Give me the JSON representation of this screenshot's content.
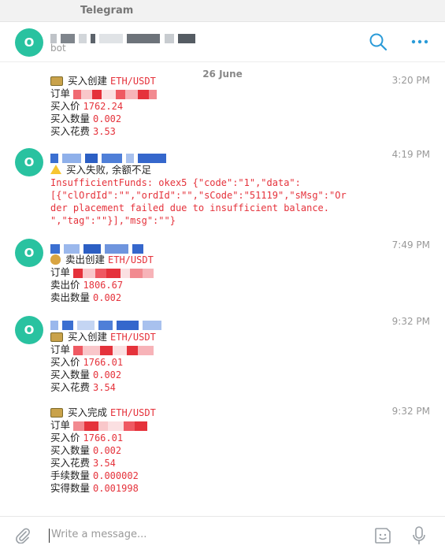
{
  "window": {
    "title": "Telegram"
  },
  "header": {
    "avatar_letter": "O",
    "subtitle": "bot"
  },
  "colors": {
    "accent": "#2a9bd8",
    "avatar": "#29c2a0",
    "red": "#e5323b"
  },
  "date_separator": "26 June",
  "messages": [
    {
      "time": "3:20 PM",
      "lines": [
        {
          "label": "买入创建",
          "value": "ETH/USDT"
        },
        {
          "label": "订单",
          "value": ""
        },
        {
          "label": "买入价",
          "value": "1762.24"
        },
        {
          "label": "买入数量",
          "value": "0.002"
        },
        {
          "label": "买入花费",
          "value": "3.53"
        }
      ]
    },
    {
      "time": "4:19 PM",
      "avatar_letter": "O",
      "title": "买入失败, 余额不足",
      "error_lines": [
        "InsufficientFunds: okex5 {\"code\":\"1\",\"data\":",
        "[{\"clOrdId\":\"\",\"ordId\":\"\",\"sCode\":\"51119\",\"sMsg\":\"Or",
        "der placement failed due to insufficient balance.",
        "\",\"tag\":\"\"}],\"msg\":\"\"}"
      ]
    },
    {
      "time": "7:49 PM",
      "avatar_letter": "O",
      "lines": [
        {
          "label": "卖出创建",
          "value": "ETH/USDT"
        },
        {
          "label": "订单",
          "value": ""
        },
        {
          "label": "卖出价",
          "value": "1806.67"
        },
        {
          "label": "卖出数量",
          "value": "0.002"
        }
      ]
    },
    {
      "time": "9:32 PM",
      "avatar_letter": "O",
      "lines": [
        {
          "label": "买入创建",
          "value": "ETH/USDT"
        },
        {
          "label": "订单",
          "value": ""
        },
        {
          "label": "买入价",
          "value": "1766.01"
        },
        {
          "label": "买入数量",
          "value": "0.002"
        },
        {
          "label": "买入花费",
          "value": "3.54"
        }
      ]
    },
    {
      "time": "9:32 PM",
      "lines": [
        {
          "label": "买入完成",
          "value": "ETH/USDT"
        },
        {
          "label": "订单",
          "value": ""
        },
        {
          "label": "买入价",
          "value": "1766.01"
        },
        {
          "label": "买入数量",
          "value": "0.002"
        },
        {
          "label": "买入花费",
          "value": "3.54"
        },
        {
          "label": "手续数量",
          "value": "0.000002"
        },
        {
          "label": "实得数量",
          "value": "0.001998"
        }
      ]
    }
  ],
  "composer": {
    "placeholder": "Write a message..."
  },
  "icons": {
    "search": "search-icon",
    "more": "more-icon",
    "attach": "paperclip-icon",
    "sticker": "sticker-icon",
    "mic": "microphone-icon"
  }
}
